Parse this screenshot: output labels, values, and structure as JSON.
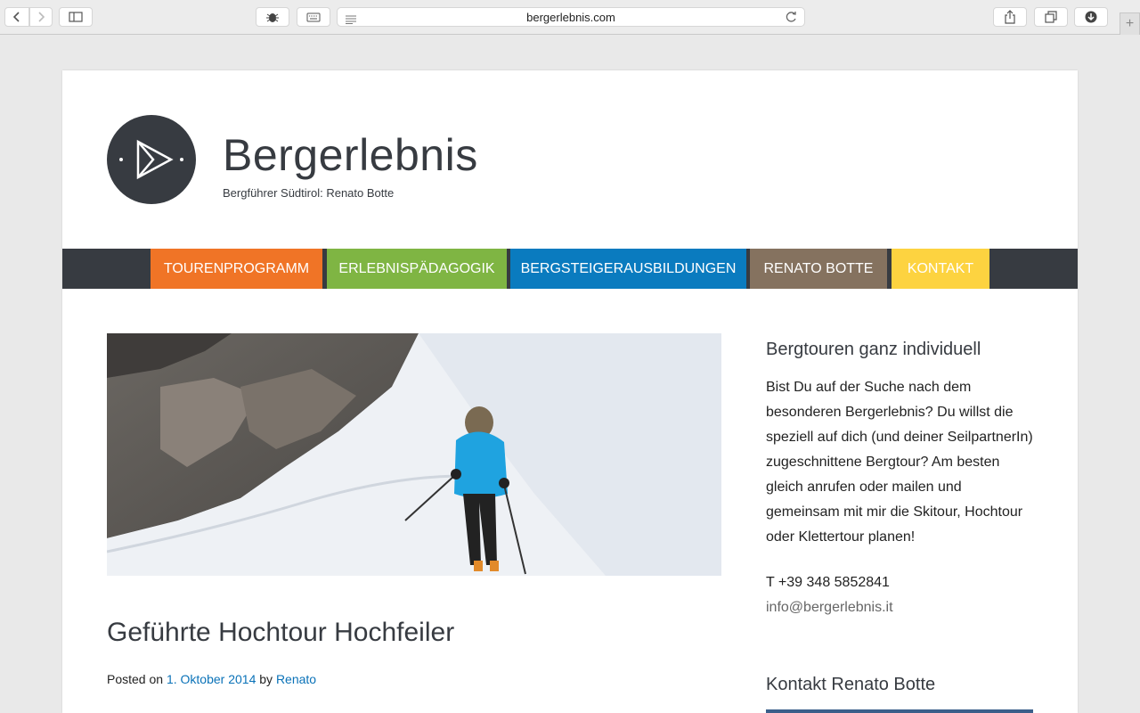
{
  "browser": {
    "url": "bergerlebnis.com"
  },
  "site": {
    "title": "Bergerlebnis",
    "tagline": "Bergführer Südtirol: Renato Botte"
  },
  "nav": {
    "items": [
      {
        "label": "Tourenprogramm",
        "color": "#f07426"
      },
      {
        "label": "Erlebnispädagogik",
        "color": "#7fb543"
      },
      {
        "label": "Bergsteigerausbildungen",
        "color": "#0a7bbf"
      },
      {
        "label": "Renato Botte",
        "color": "#85725f"
      },
      {
        "label": "Kontakt",
        "color": "#fdd340"
      }
    ]
  },
  "post": {
    "title": "Geführte Hochtour Hochfeiler",
    "posted_on_label": "Posted on",
    "date": "1. Oktober 2014",
    "by_label": "by",
    "author": "Renato"
  },
  "sidebar": {
    "widget1": {
      "title": "Bergtouren ganz individuell",
      "text": "Bist Du auf der Suche nach dem besonderen Bergerlebnis? Du willst die speziell auf dich (und deiner SeilpartnerIn) zugeschnittene Bergtour? Am besten gleich anrufen oder mailen und gemeinsam mit mir die Skitour, Hochtour oder Klettertour planen!",
      "phone": "T +39 348 5852841",
      "email": "info@bergerlebnis.it"
    },
    "widget2": {
      "title": "Kontakt Renato Botte"
    }
  },
  "icons": {
    "back": "chevron-left-icon",
    "forward": "chevron-right-icon",
    "sidebar": "sidebar-icon",
    "bug": "bug-icon",
    "keyboard": "keyboard-icon",
    "reader": "reader-icon",
    "reload": "reload-icon",
    "share": "share-icon",
    "tabs": "tabs-icon",
    "download": "download-icon",
    "new_tab": "plus-icon"
  }
}
